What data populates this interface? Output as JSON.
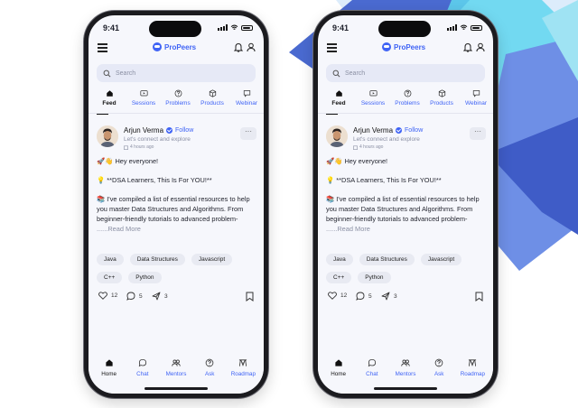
{
  "colors": {
    "brand": "#3f63f5",
    "deco_dark": "#3f5cc7",
    "deco_cyan": "#5fd6ee",
    "deco_mid": "#6e8fe6"
  },
  "phones": [
    {
      "status_time": "9:41",
      "brand_name": "ProPeers",
      "search_placeholder": "Search",
      "tabs": [
        {
          "label": "Feed",
          "icon": "home-icon",
          "active": true
        },
        {
          "label": "Sessions",
          "icon": "sessions-icon"
        },
        {
          "label": "Problems",
          "icon": "question-icon"
        },
        {
          "label": "Products",
          "icon": "cube-icon"
        },
        {
          "label": "Webinar",
          "icon": "chat-box-icon"
        }
      ],
      "post": {
        "author": "Arjun Verma",
        "follow_label": "Follow",
        "tagline": "Let's connect and explore",
        "time": "4 hours ago",
        "more": "···",
        "lines": [
          "🚀👋 Hey everyone!",
          "",
          "💡 **DSA Learners, This Is For YOU!**",
          "",
          "📚 I've compiled a list of essential resources to help",
          "you master Data Structures and Algorithms. From",
          "beginner-friendly tutorials to advanced problem-"
        ],
        "read_more_prefix": "......",
        "read_more": "Read More",
        "tags": [
          "Java",
          "Data Structures",
          "Javascript",
          "C++",
          "Python"
        ],
        "likes": "12",
        "comments": "5",
        "shares": "3"
      },
      "nav": [
        {
          "label": "Home",
          "icon": "home-icon",
          "active": true
        },
        {
          "label": "Chat",
          "icon": "chat-icon"
        },
        {
          "label": "Mentors",
          "icon": "mentors-icon"
        },
        {
          "label": "Ask",
          "icon": "question-icon"
        },
        {
          "label": "Roadmap",
          "icon": "roadmap-icon"
        }
      ]
    },
    {
      "status_time": "9:41",
      "brand_name": "ProPeers",
      "search_placeholder": "Search",
      "tabs": [
        {
          "label": "Feed",
          "icon": "home-icon",
          "active": true
        },
        {
          "label": "Sessions",
          "icon": "sessions-icon"
        },
        {
          "label": "Problems",
          "icon": "question-icon"
        },
        {
          "label": "Products",
          "icon": "cube-icon"
        },
        {
          "label": "Webinar",
          "icon": "chat-box-icon"
        }
      ],
      "post": {
        "author": "Arjun Verma",
        "follow_label": "Follow",
        "tagline": "Let's connect and explore",
        "time": "4 hours ago",
        "more": "···",
        "lines": [
          "🚀👋 Hey everyone!",
          "",
          "💡 **DSA Learners, This Is For YOU!**",
          "",
          "📚 I've compiled a list of essential resources to help",
          "you master Data Structures and Algorithms. From",
          "beginner-friendly tutorials to advanced problem-"
        ],
        "read_more_prefix": "......",
        "read_more": "Read More",
        "tags": [
          "Java",
          "Data Structures",
          "Javascript",
          "C++",
          "Python"
        ],
        "likes": "12",
        "comments": "5",
        "shares": "3"
      },
      "nav": [
        {
          "label": "Home",
          "icon": "home-icon",
          "active": true
        },
        {
          "label": "Chat",
          "icon": "chat-icon"
        },
        {
          "label": "Mentors",
          "icon": "mentors-icon"
        },
        {
          "label": "Ask",
          "icon": "question-icon"
        },
        {
          "label": "Roadmap",
          "icon": "roadmap-icon"
        }
      ]
    }
  ]
}
